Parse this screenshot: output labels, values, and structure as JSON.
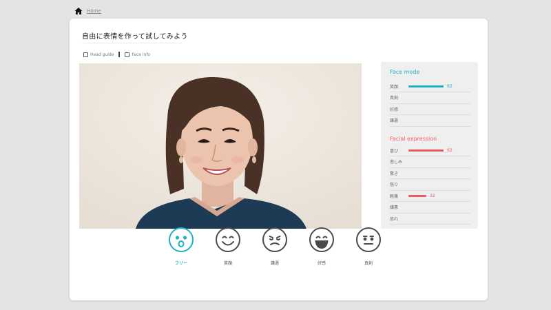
{
  "breadcrumb": {
    "home_label": "Home"
  },
  "title": "自由に表情を作って試してみよう",
  "toggles": {
    "head_guide": "Head guide",
    "face_info": "Face info"
  },
  "face_mode": {
    "title": "Face mode",
    "color": "#1fb1c5",
    "rows": [
      {
        "label": "笑顔",
        "value": "62",
        "fraction": 0.62
      },
      {
        "label": "真剣",
        "value": "",
        "fraction": 0
      },
      {
        "label": "好感",
        "value": "",
        "fraction": 0
      },
      {
        "label": "謙遜",
        "value": "",
        "fraction": 0
      }
    ]
  },
  "facial_expression": {
    "title": "Facial expression",
    "color": "#ee5b62",
    "rows": [
      {
        "label": "喜び",
        "value": "62",
        "fraction": 0.62
      },
      {
        "label": "悲しみ",
        "value": "",
        "fraction": 0
      },
      {
        "label": "驚き",
        "value": "",
        "fraction": 0
      },
      {
        "label": "怒り",
        "value": "",
        "fraction": 0
      },
      {
        "label": "軽蔑",
        "value": "32",
        "fraction": 0.32
      },
      {
        "label": "嫌悪",
        "value": "",
        "fraction": 0
      },
      {
        "label": "恐れ",
        "value": "",
        "fraction": 0
      }
    ]
  },
  "face_buttons": [
    {
      "label": "フリー",
      "icon": "free-face-icon",
      "active": true
    },
    {
      "label": "笑顔",
      "icon": "smile-face-icon",
      "active": false
    },
    {
      "label": "謙遜",
      "icon": "modest-face-icon",
      "active": false
    },
    {
      "label": "好感",
      "icon": "grin-face-icon",
      "active": false
    },
    {
      "label": "真剣",
      "icon": "serious-face-icon",
      "active": false
    }
  ]
}
